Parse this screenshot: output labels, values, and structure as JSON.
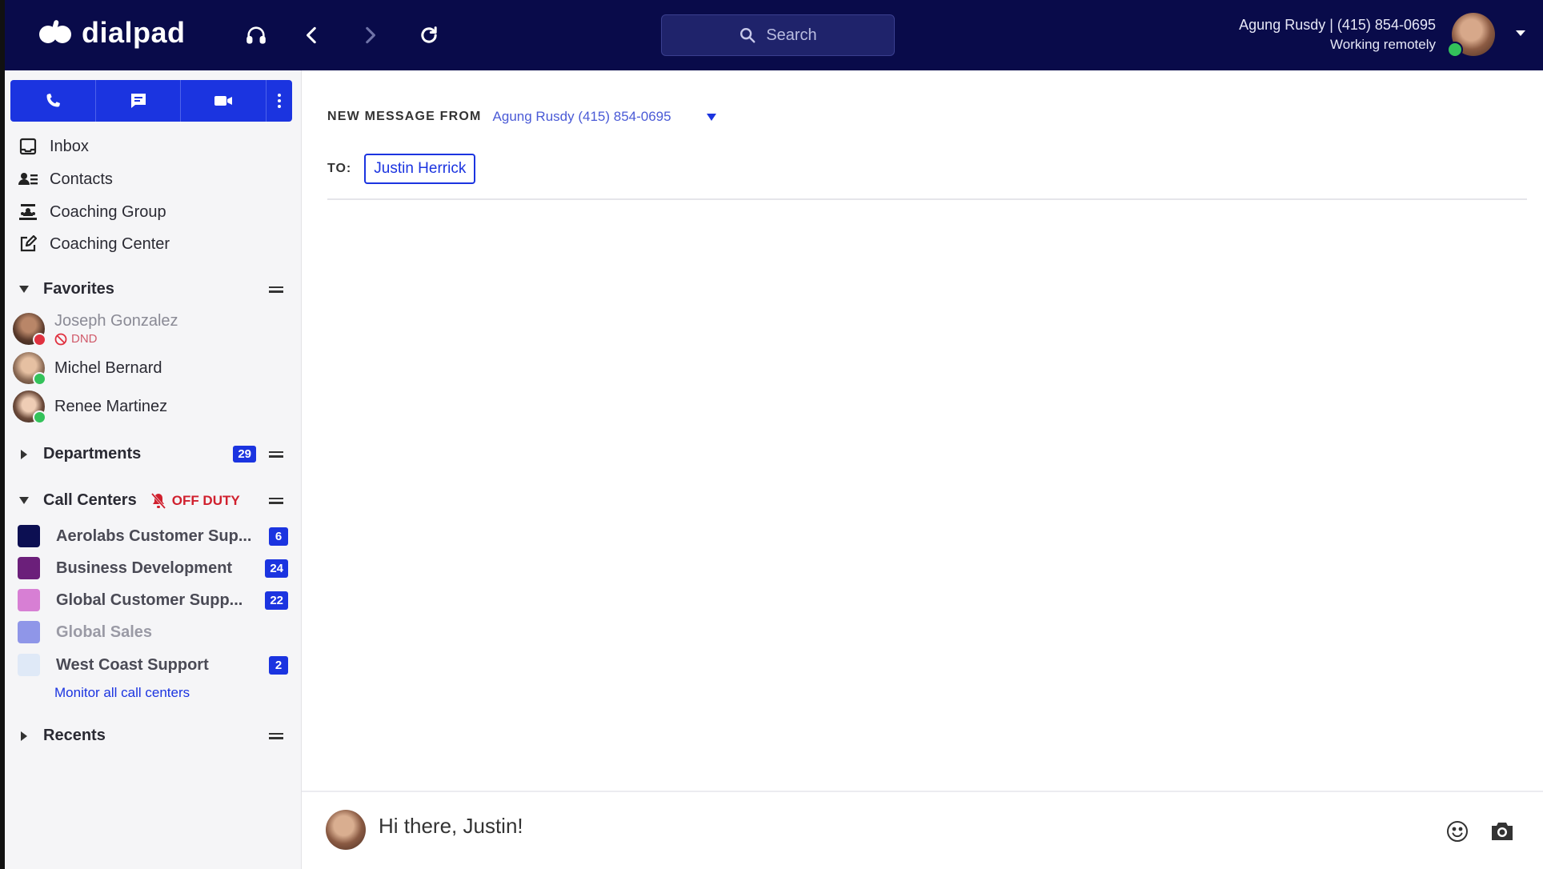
{
  "app": {
    "name": "dialpad"
  },
  "header": {
    "search_placeholder": "Search",
    "user_line": "Agung Rusdy | (415) 854-0695",
    "user_status": "Working remotely",
    "icons": [
      "headset-icon",
      "back-arrow-icon",
      "forward-arrow-icon",
      "refresh-icon",
      "search-icon",
      "chevron-down-icon"
    ]
  },
  "sidebar": {
    "action_icons": [
      "phone-icon",
      "message-icon",
      "video-icon",
      "more-vertical-icon"
    ],
    "nav": [
      {
        "label": "Inbox",
        "icon": "inbox-icon"
      },
      {
        "label": "Contacts",
        "icon": "contacts-icon"
      },
      {
        "label": "Coaching Group",
        "icon": "coaching-group-icon"
      },
      {
        "label": "Coaching Center",
        "icon": "edit-icon"
      }
    ],
    "favorites": {
      "title": "Favorites",
      "items": [
        {
          "name": "Joseph Gonzalez",
          "status_text": "DND",
          "status_color": "#e0313f"
        },
        {
          "name": "Michel Bernard",
          "status_color": "#33c25a"
        },
        {
          "name": "Renee Martinez",
          "status_color": "#33c25a"
        }
      ]
    },
    "departments": {
      "title": "Departments",
      "count": "29"
    },
    "call_centers": {
      "title": "Call Centers",
      "status": "OFF DUTY",
      "items": [
        {
          "name": "Aerolabs Customer Sup...",
          "color": "#0c0f52",
          "count": "6"
        },
        {
          "name": "Business Development",
          "color": "#6b1f7a",
          "count": "24"
        },
        {
          "name": "Global Customer Supp...",
          "color": "#d77fd4",
          "count": "22"
        },
        {
          "name": "Global Sales",
          "color": "#8f96e8",
          "count": ""
        },
        {
          "name": "West Coast Support",
          "color": "#dfe9f7",
          "count": "2"
        }
      ],
      "monitor_link": "Monitor all call centers"
    },
    "recents": {
      "title": "Recents"
    }
  },
  "message": {
    "from_label": "NEW MESSAGE FROM",
    "from_value": "Agung Rusdy (415) 854-0695",
    "to_label": "TO:",
    "recipient": "Justin Herrick",
    "draft_text": "Hi there, Justin!"
  },
  "colors": {
    "topbar": "#090b4a",
    "accent": "#1b34e0",
    "off_duty": "#d0202e"
  }
}
